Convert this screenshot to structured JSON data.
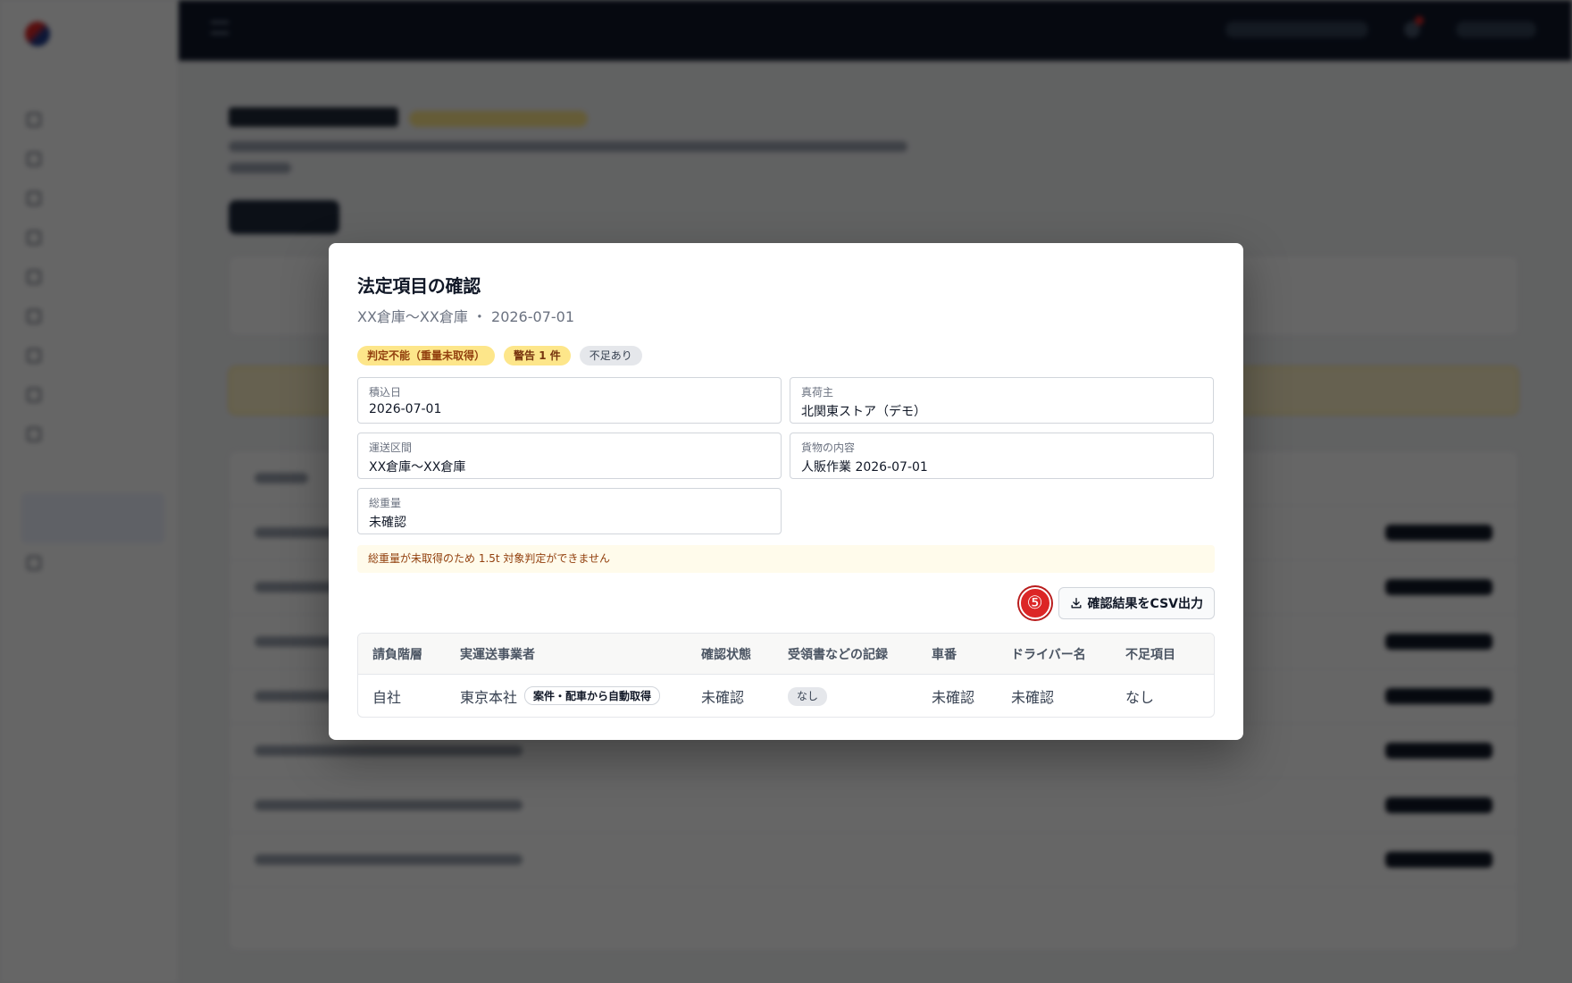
{
  "modal": {
    "title": "法定項目の確認",
    "subtitle": "XX倉庫～XX倉庫 ・ 2026-07-01",
    "badges": [
      "判定不能（重量未取得）",
      "警告 1 件",
      "不足あり"
    ],
    "fields": [
      {
        "label": "積込日",
        "value": "2026-07-01"
      },
      {
        "label": "真荷主",
        "value": "北関東ストア（デモ）"
      },
      {
        "label": "運送区間",
        "value": "XX倉庫～XX倉庫"
      },
      {
        "label": "貨物の内容",
        "value": "人販作業 2026-07-01"
      },
      {
        "label": "総重量",
        "value": "未確認"
      }
    ],
    "notice": "総重量が未取得のため 1.5t 対象判定ができません",
    "step_marker": "⑤",
    "csv_button": "確認結果をCSV出力",
    "table": {
      "headers": [
        "請負階層",
        "実運送事業者",
        "確認状態",
        "受領書などの記録",
        "車番",
        "ドライバー名",
        "不足項目"
      ],
      "rows": [
        {
          "tier": "自社",
          "carrier": "東京本社",
          "carrier_tag": "案件・配車から自動取得",
          "status": "未確認",
          "record": "なし",
          "vehicle": "未確認",
          "driver": "未確認",
          "missing": "なし"
        }
      ]
    }
  },
  "colors": {
    "overlay": "#000000",
    "step_marker": "#dc2626",
    "notice_bg": "#fffbeb",
    "badge_warning": "#fde68a"
  },
  "icons": {
    "csv_button_icon": "download-icon"
  }
}
